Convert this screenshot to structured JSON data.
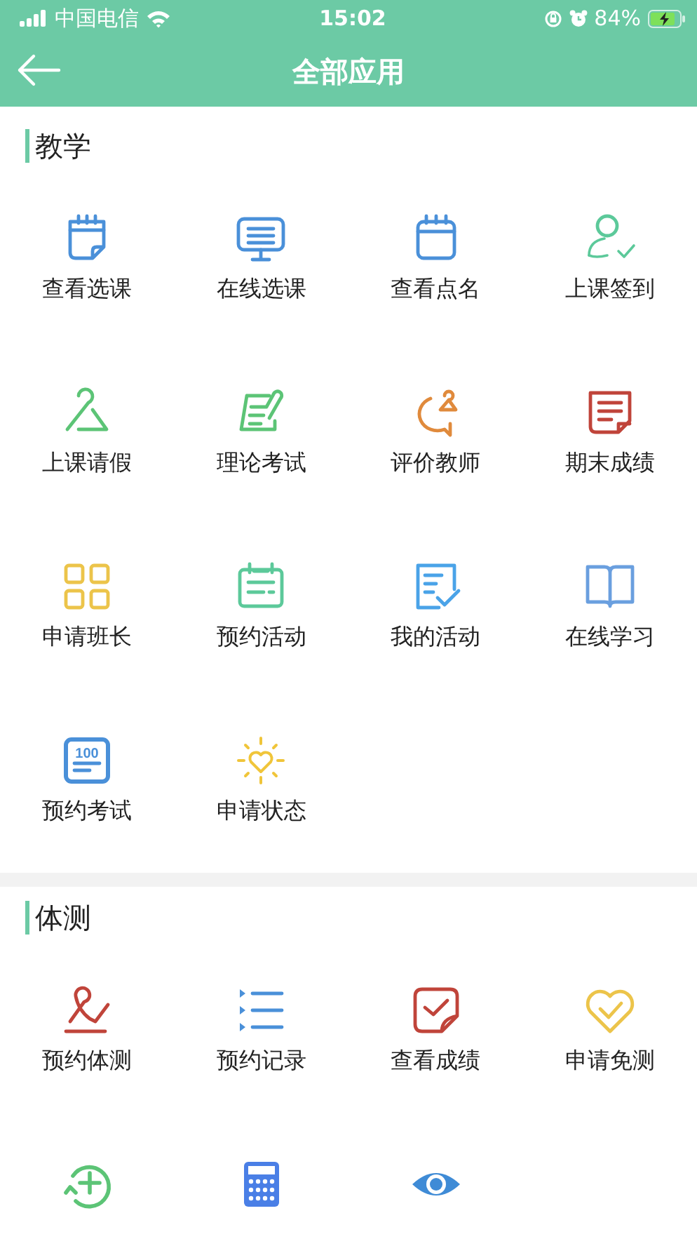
{
  "status_bar": {
    "carrier": "中国电信",
    "time": "15:02",
    "battery": "84%"
  },
  "header": {
    "title": "全部应用"
  },
  "sections": [
    {
      "title": "教学",
      "items": [
        {
          "label": "查看选课",
          "color": "#4a90d9"
        },
        {
          "label": "在线选课",
          "color": "#4a90d9"
        },
        {
          "label": "查看点名",
          "color": "#4a90d9"
        },
        {
          "label": "上课签到",
          "color": "#5cc99a"
        },
        {
          "label": "上课请假",
          "color": "#5cc476"
        },
        {
          "label": "理论考试",
          "color": "#5cc476"
        },
        {
          "label": "评价教师",
          "color": "#e08a3c"
        },
        {
          "label": "期末成绩",
          "color": "#c0443a"
        },
        {
          "label": "申请班长",
          "color": "#ecc44a"
        },
        {
          "label": "预约活动",
          "color": "#5cc99a"
        },
        {
          "label": "我的活动",
          "color": "#4aa3e8"
        },
        {
          "label": "在线学习",
          "color": "#6a9fdf"
        },
        {
          "label": "预约考试",
          "color": "#4a90d9",
          "badge_text": "100"
        },
        {
          "label": "申请状态",
          "color": "#f0c53a"
        }
      ]
    },
    {
      "title": "体测",
      "items": [
        {
          "label": "预约体测",
          "color": "#c0443a"
        },
        {
          "label": "预约记录",
          "color": "#4a90d9"
        },
        {
          "label": "查看成绩",
          "color": "#c0443a"
        },
        {
          "label": "申请免测",
          "color": "#ecc44a"
        },
        {
          "color": "#5cc476"
        },
        {
          "color": "#4a7fe6"
        },
        {
          "color": "#3f8bd6"
        }
      ]
    }
  ]
}
